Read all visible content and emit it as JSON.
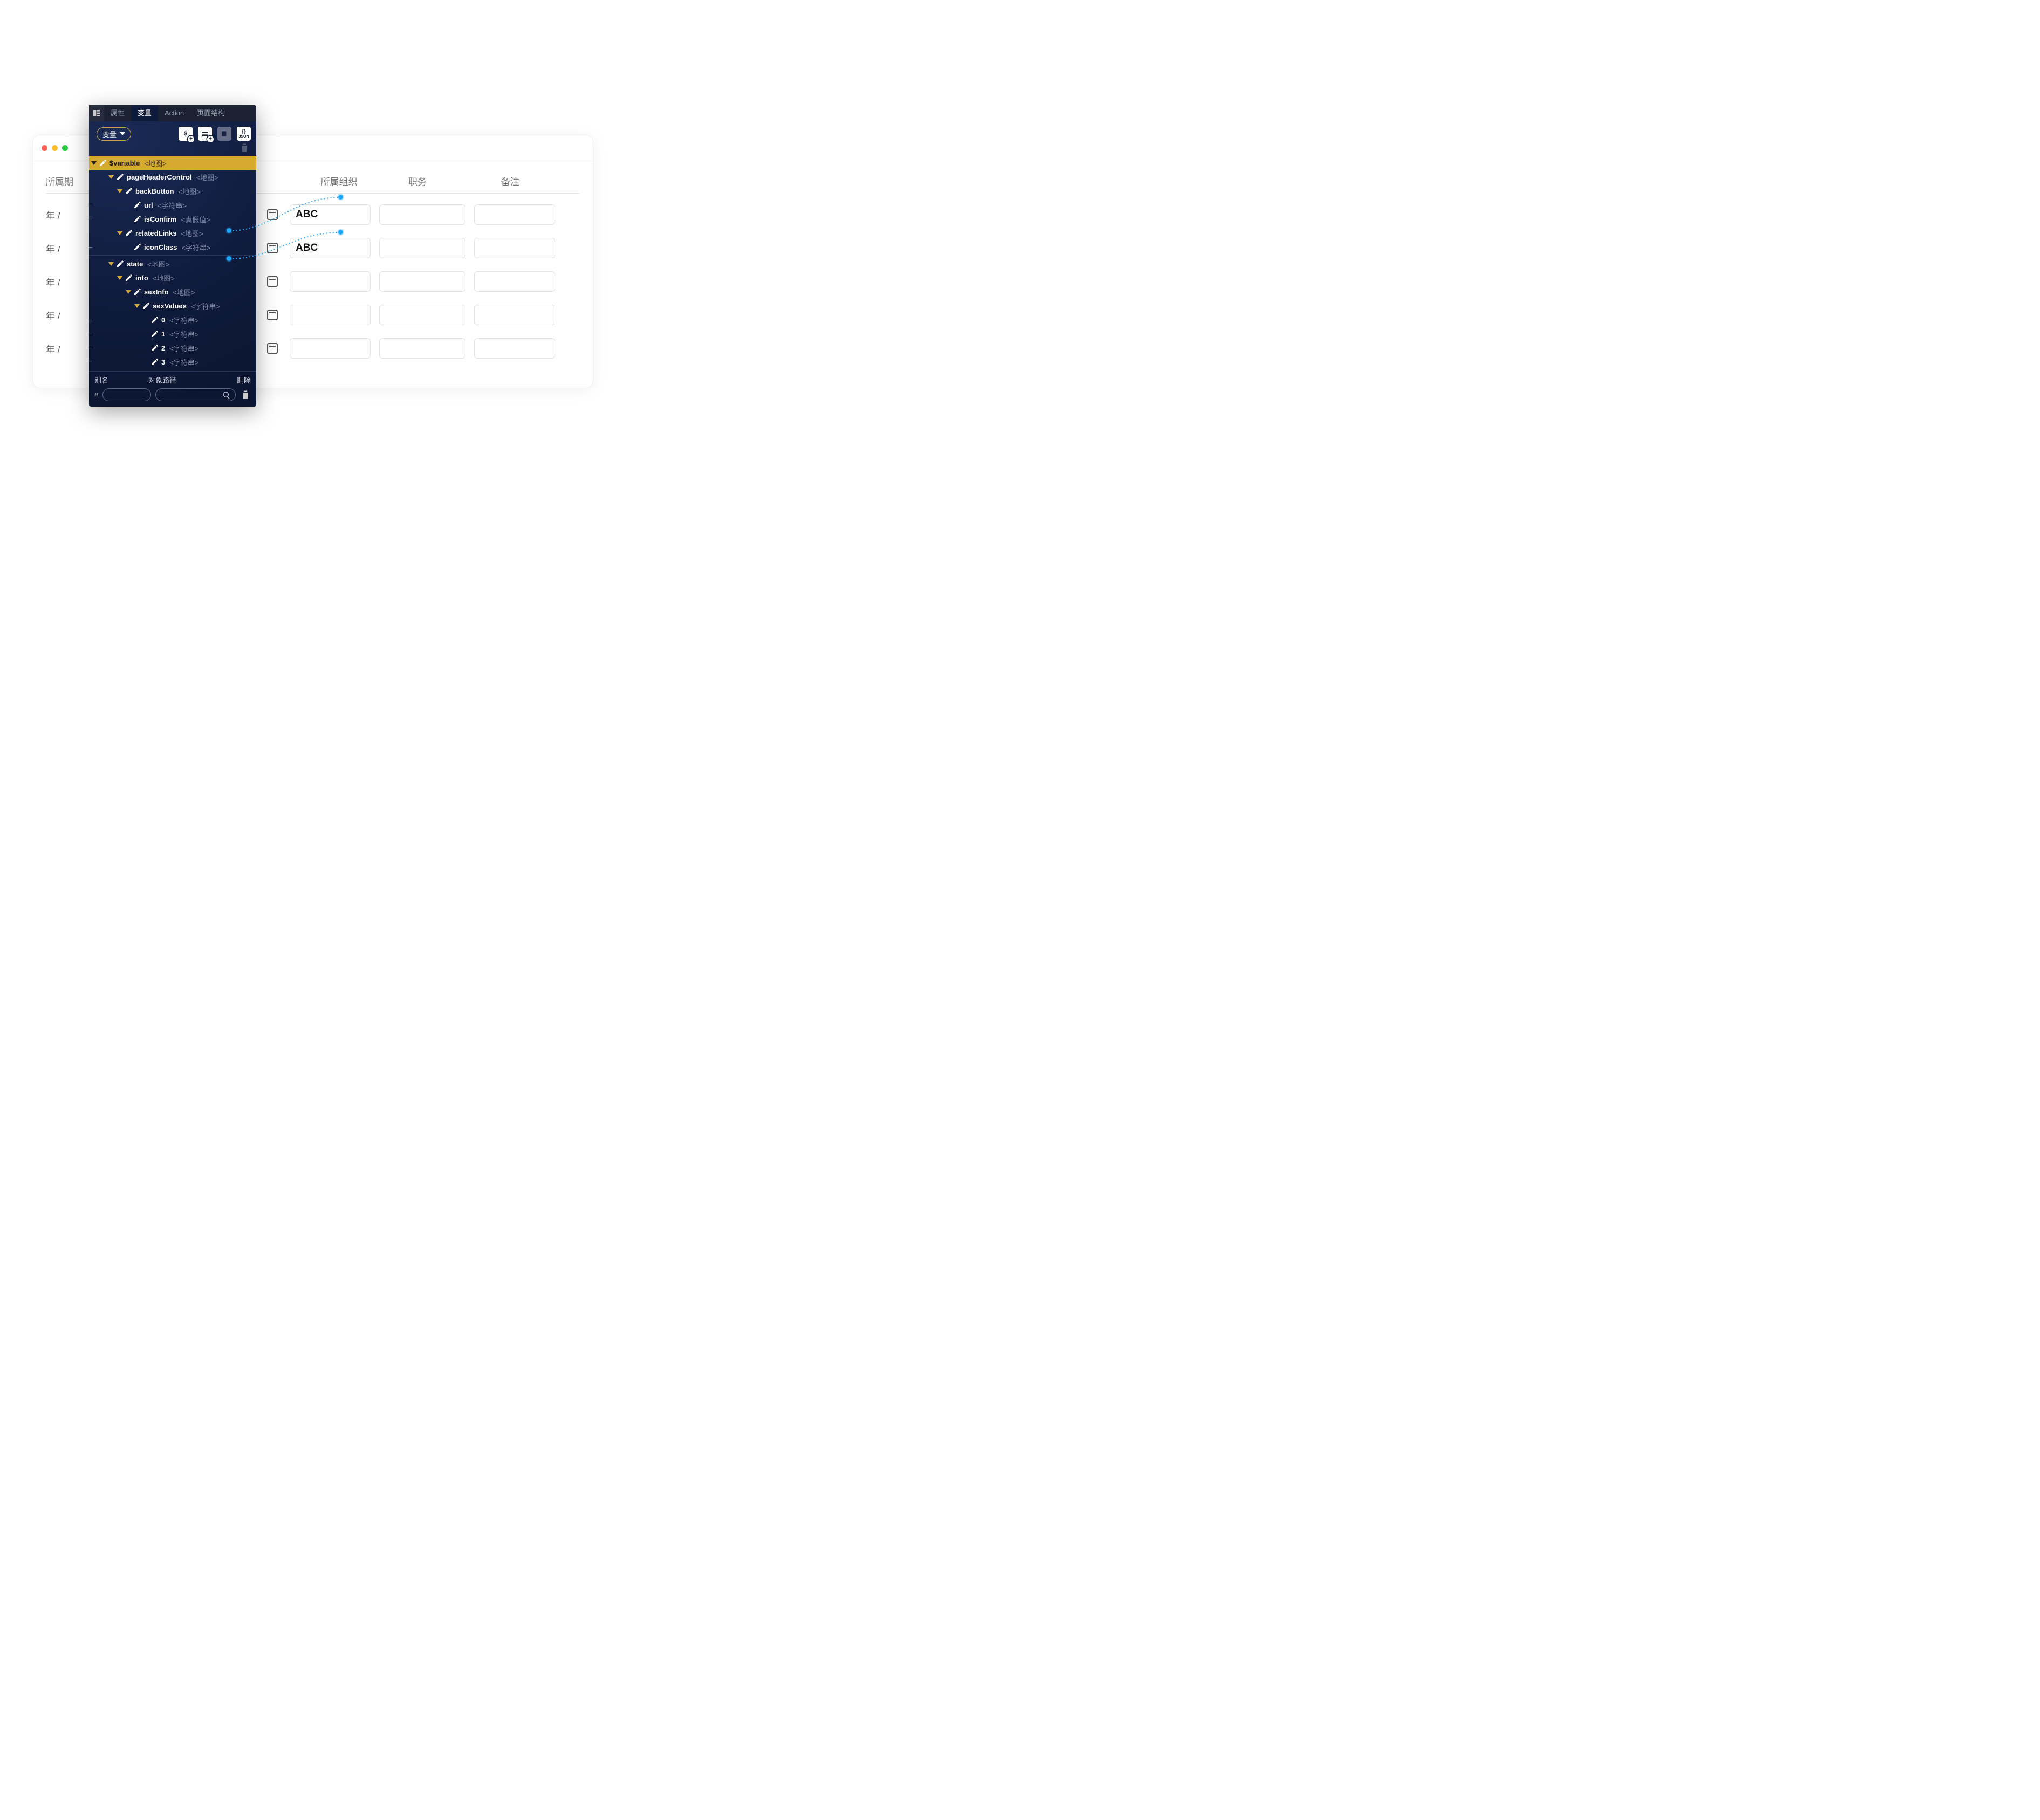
{
  "browser": {
    "columns": {
      "period": "所属期",
      "org": "所属组织",
      "job": "职务",
      "note": "备注"
    },
    "period_label": "年 /",
    "rows": [
      {
        "org": "ABC"
      },
      {
        "org": "ABC"
      },
      {
        "org": ""
      },
      {
        "org": ""
      },
      {
        "org": ""
      }
    ]
  },
  "inspector": {
    "tabs": {
      "props": "属性",
      "vars": "变量",
      "action": "Action",
      "page_struct": "页面结构"
    },
    "pill_label": "变量",
    "toolbar": {
      "dollar": "$",
      "json": "JSON",
      "braces": "{}"
    },
    "tree": [
      {
        "id": "root",
        "depth": 0,
        "name": "$variable",
        "type": "<地图>",
        "root": true,
        "open": true
      },
      {
        "id": "phc",
        "depth": 1,
        "name": "pageHeaderControl",
        "type": "<地图>",
        "open": true
      },
      {
        "id": "bb",
        "depth": 2,
        "name": "backButton",
        "type": "<地图>",
        "open": true
      },
      {
        "id": "url",
        "depth": 3,
        "name": "url",
        "type": "<字符串>",
        "leaf": true
      },
      {
        "id": "isc",
        "depth": 3,
        "name": "isConfirm",
        "type": "<真假值>",
        "leaf": true
      },
      {
        "id": "rl",
        "depth": 2,
        "name": "relatedLinks",
        "type": "<地图>",
        "open": true
      },
      {
        "id": "ic",
        "depth": 3,
        "name": "iconClass",
        "type": "<字符串>",
        "leaf": true
      },
      {
        "id": "sep1",
        "sep": true
      },
      {
        "id": "state",
        "depth": 1,
        "name": "state",
        "type": "<地图>",
        "open": true
      },
      {
        "id": "info",
        "depth": 2,
        "name": "info",
        "type": "<地图>",
        "open": true
      },
      {
        "id": "si",
        "depth": 3,
        "name": "sexInfo",
        "type": "<地图>",
        "open": true
      },
      {
        "id": "sv",
        "depth": 4,
        "name": "sexValues",
        "type": "<字符串>",
        "open": true
      },
      {
        "id": "v0",
        "depth": 5,
        "name": "0",
        "type": "<字符串>",
        "leaf": true
      },
      {
        "id": "v1",
        "depth": 5,
        "name": "1",
        "type": "<字符串>",
        "leaf": true
      },
      {
        "id": "v2",
        "depth": 5,
        "name": "2",
        "type": "<字符串>",
        "leaf": true
      },
      {
        "id": "v3",
        "depth": 5,
        "name": "3",
        "type": "<字符串>",
        "leaf": true
      }
    ],
    "footer": {
      "alias": "别名",
      "path": "对象路径",
      "delete": "删除",
      "hash": "#"
    }
  }
}
